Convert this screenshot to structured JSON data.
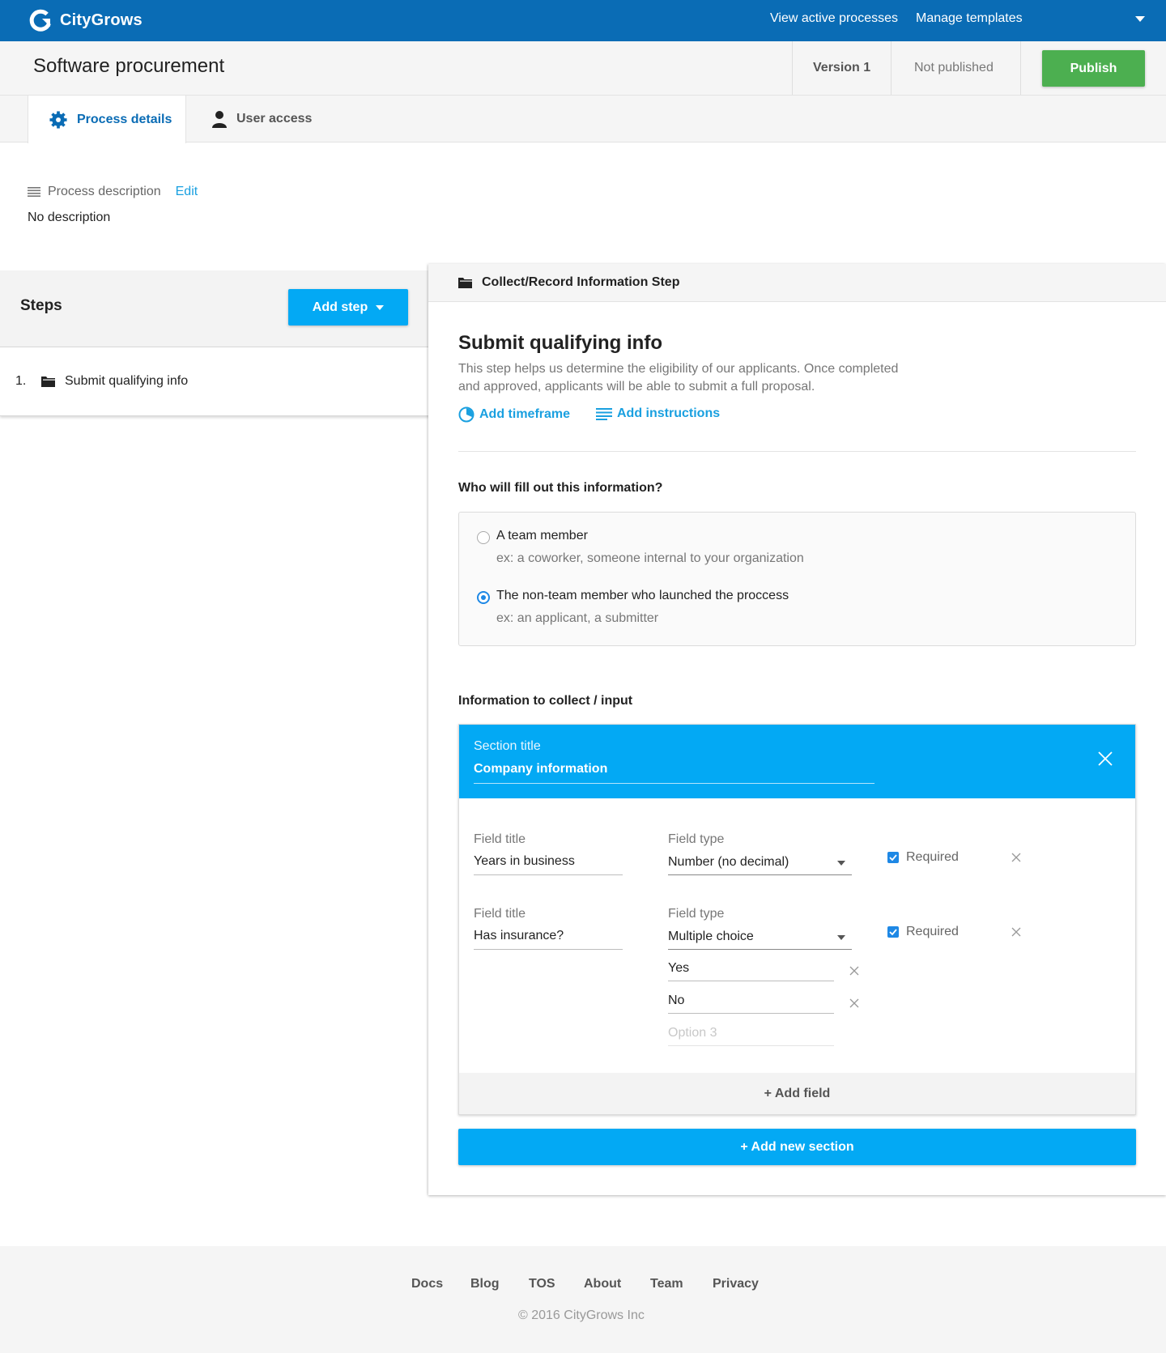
{
  "nav": {
    "brand": "CityGrows",
    "links": [
      "View active processes",
      "Manage templates"
    ]
  },
  "titlebar": {
    "title": "Software procurement",
    "version": "Version 1",
    "status": "Not published",
    "publish_label": "Publish"
  },
  "tabs": [
    {
      "label": "Process details",
      "icon": "gear-icon",
      "active": true
    },
    {
      "label": "User access",
      "icon": "user-icon",
      "active": false
    }
  ],
  "description": {
    "label": "Process description",
    "edit_label": "Edit",
    "value": "No description"
  },
  "steps": {
    "title": "Steps",
    "add_label": "Add step",
    "items": [
      {
        "number": "1.",
        "name": "Submit qualifying info",
        "icon": "folder-icon"
      }
    ]
  },
  "detail": {
    "header": "Collect/Record Information Step",
    "step_name": "Submit qualifying info",
    "step_description": "This step helps us determine the eligibility of our applicants. Once completed and approved, applicants will be able to submit a full proposal.",
    "add_timeframe": "Add timeframe",
    "add_instructions": "Add instructions",
    "who_label": "Who will fill out this information?",
    "who_options": [
      {
        "label": "A team member",
        "hint": "ex: a coworker, someone internal to your organization",
        "selected": false
      },
      {
        "label": "The non-team member who launched the proccess",
        "hint": "ex: an applicant, a submitter",
        "selected": true
      }
    ],
    "info_label": "Information to collect / input",
    "section": {
      "title_label": "Section title",
      "title_value": "Company information",
      "fields": [
        {
          "title_label": "Field title",
          "title": "Years in business",
          "type_label": "Field type",
          "type": "Number (no decimal)",
          "required_label": "Required",
          "required": true
        },
        {
          "title_label": "Field title",
          "title": "Has insurance?",
          "type_label": "Field type",
          "type": "Multiple choice",
          "required_label": "Required",
          "required": true,
          "options": [
            "Yes",
            "No"
          ],
          "option_placeholder": "Option 3"
        }
      ],
      "add_field": "+ Add field"
    },
    "add_section": "+ Add new section"
  },
  "footer": {
    "links": [
      "Docs",
      "Blog",
      "TOS",
      "About",
      "Team",
      "Privacy"
    ],
    "copyright": "© 2016 CityGrows Inc"
  },
  "colors": {
    "nav_bg": "#0a6cb5",
    "accent": "#03a9f4",
    "link": "#1aa0e0",
    "publish": "#4caf50"
  }
}
